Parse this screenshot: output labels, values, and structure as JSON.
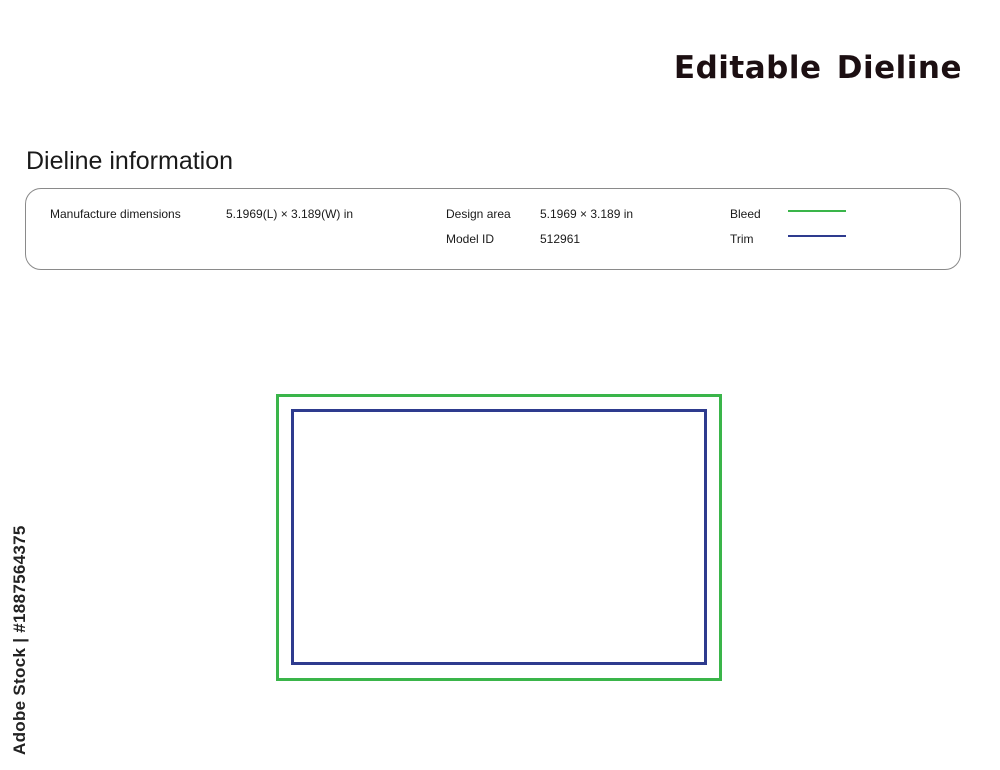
{
  "header": {
    "title": "Editable Dieline"
  },
  "info": {
    "section_title": "Dieline information",
    "manufacture_label": "Manufacture dimensions",
    "manufacture_value": "5.1969(L) × 3.189(W) in",
    "design_area_label": "Design area",
    "design_area_value": "5.1969 × 3.189 in",
    "model_id_label": "Model ID",
    "model_id_value": "512961",
    "legend": [
      {
        "label": "Bleed",
        "color": "#3ab54a"
      },
      {
        "label": "Trim",
        "color": "#2e3b8e"
      }
    ]
  },
  "watermark": {
    "side_text": "Adobe Stock | #1887564375"
  }
}
